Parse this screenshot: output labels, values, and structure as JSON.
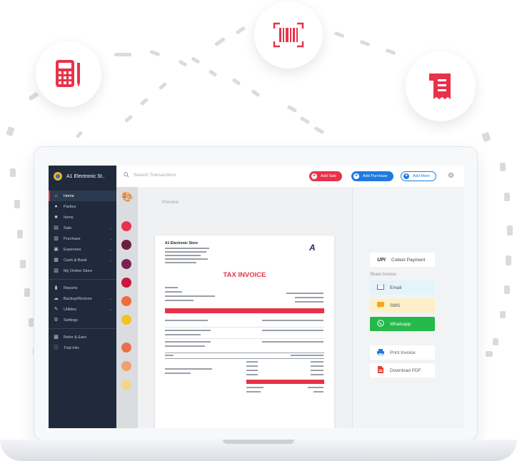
{
  "floating_icons": [
    {
      "name": "calculator-icon",
      "color": "#e8324a"
    },
    {
      "name": "barcode-icon",
      "color": "#e8324a"
    },
    {
      "name": "receipt-icon",
      "color": "#e8324a"
    }
  ],
  "app": {
    "company_name": "A1 Electronic St..",
    "search_placeholder": "Search Transactions",
    "accent": "#e8324a"
  },
  "sidebar": {
    "items": [
      {
        "label": "Home",
        "icon": "home-icon",
        "active": true
      },
      {
        "label": "Parties",
        "icon": "people-icon"
      },
      {
        "label": "Items",
        "icon": "box-icon"
      },
      {
        "label": "Sale",
        "icon": "receipt-icon",
        "chevron": true
      },
      {
        "label": "Purchase",
        "icon": "cart-icon",
        "chevron": true
      },
      {
        "label": "Expenses",
        "icon": "wallet-icon",
        "chevron": true
      },
      {
        "label": "Cash & Bank",
        "icon": "bank-icon",
        "chevron": true
      },
      {
        "label": "My Online Store",
        "icon": "store-icon"
      },
      {
        "label": "Reports",
        "icon": "chart-icon"
      },
      {
        "label": "Backup/Restore",
        "icon": "cloud-icon",
        "chevron": true
      },
      {
        "label": "Utilities",
        "icon": "wrench-icon",
        "chevron": true
      },
      {
        "label": "Settings",
        "icon": "gear-icon"
      },
      {
        "label": "Refer & Earn",
        "icon": "gift-icon"
      },
      {
        "label": "Trial Info",
        "icon": "info-icon"
      }
    ]
  },
  "topbar": {
    "add_sale": "Add Sale",
    "add_purchase": "Add Purchase",
    "add_more": "Add More"
  },
  "theme_swatches": [
    "#e8324a",
    "#6a1f3d",
    "#7b2252",
    "#c8163e",
    "#f26b3a",
    "#f7c21f",
    "#e8704a",
    "#f0a070",
    "#f3d58a"
  ],
  "preview": {
    "label": "Preview",
    "invoice": {
      "store_name": "A1 Electronic Store",
      "title": "TAX INVOICE"
    }
  },
  "share_panel": {
    "upi_badge": "UPI",
    "collect_payment": "Collect Payment",
    "share_invoice": "Share Invoice",
    "email": "Email",
    "sms": "SMS",
    "whatsapp": "Whatsapp",
    "print_invoice": "Print Invoice",
    "download_pdf": "Download PDF"
  }
}
